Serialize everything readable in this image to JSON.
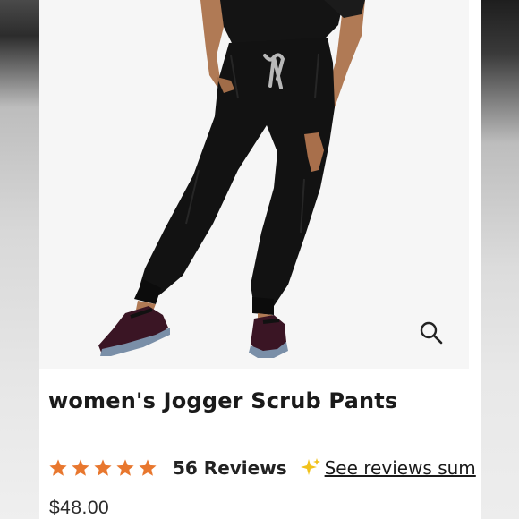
{
  "product": {
    "image_icon": "product-photo",
    "zoom_icon": "magnifier-icon",
    "title": "women's Jogger Scrub Pants",
    "rating": 5,
    "reviews_label": "56 Reviews",
    "summary_link": "See reviews sum",
    "price": "$48.00"
  },
  "colors": {
    "star": "#e8772e",
    "sparkle": "#f1c21b",
    "pants": "#121212",
    "background": "#f6f6f6"
  }
}
